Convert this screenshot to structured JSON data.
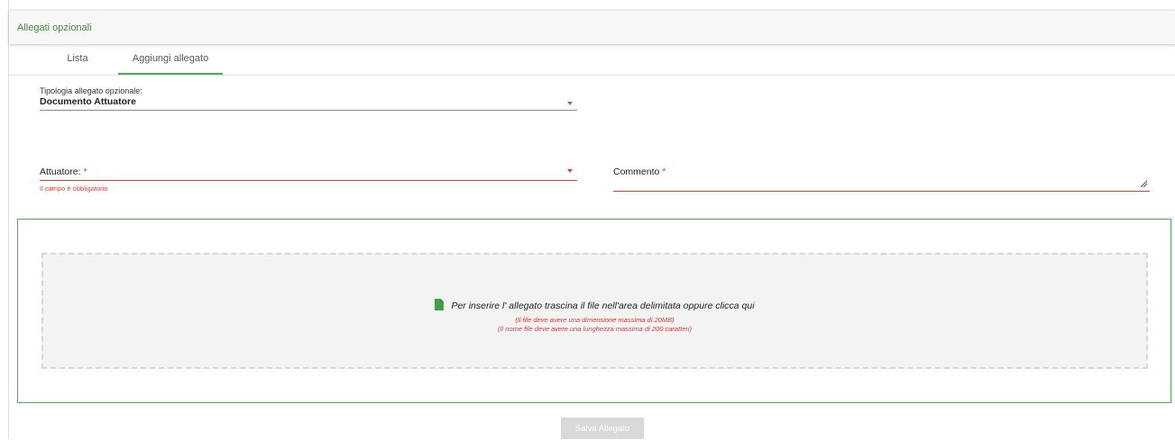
{
  "panel": {
    "title": "Allegati opzionali"
  },
  "tabs": [
    {
      "label": "Lista",
      "active": false
    },
    {
      "label": "Aggiungi allegato",
      "active": true
    }
  ],
  "form": {
    "tipologia": {
      "label": "Tipologia allegato opzionale:",
      "value": "Documento Attuatore"
    },
    "attuatore": {
      "label": "Attuatore:",
      "required_mark": "*",
      "value": "",
      "error": "Il campo è obbligatorio"
    },
    "commento": {
      "label": "Commento",
      "required_mark": "*",
      "value": ""
    }
  },
  "dropzone": {
    "text": "Per inserire l' allegato trascina il file nell'area delimitata oppure clicca qui",
    "note1": "(Il file deve avere una dimensione massima di 20MB)",
    "note2": "(Il nome file deve avere una lunghezza massima di 200 caratteri)",
    "icon": "file-icon"
  },
  "actions": {
    "save_label": "Salva Allegato",
    "save_enabled": false
  },
  "colors": {
    "accent": "#4caf50",
    "error": "#e53935",
    "title": "#3d8b3d"
  }
}
